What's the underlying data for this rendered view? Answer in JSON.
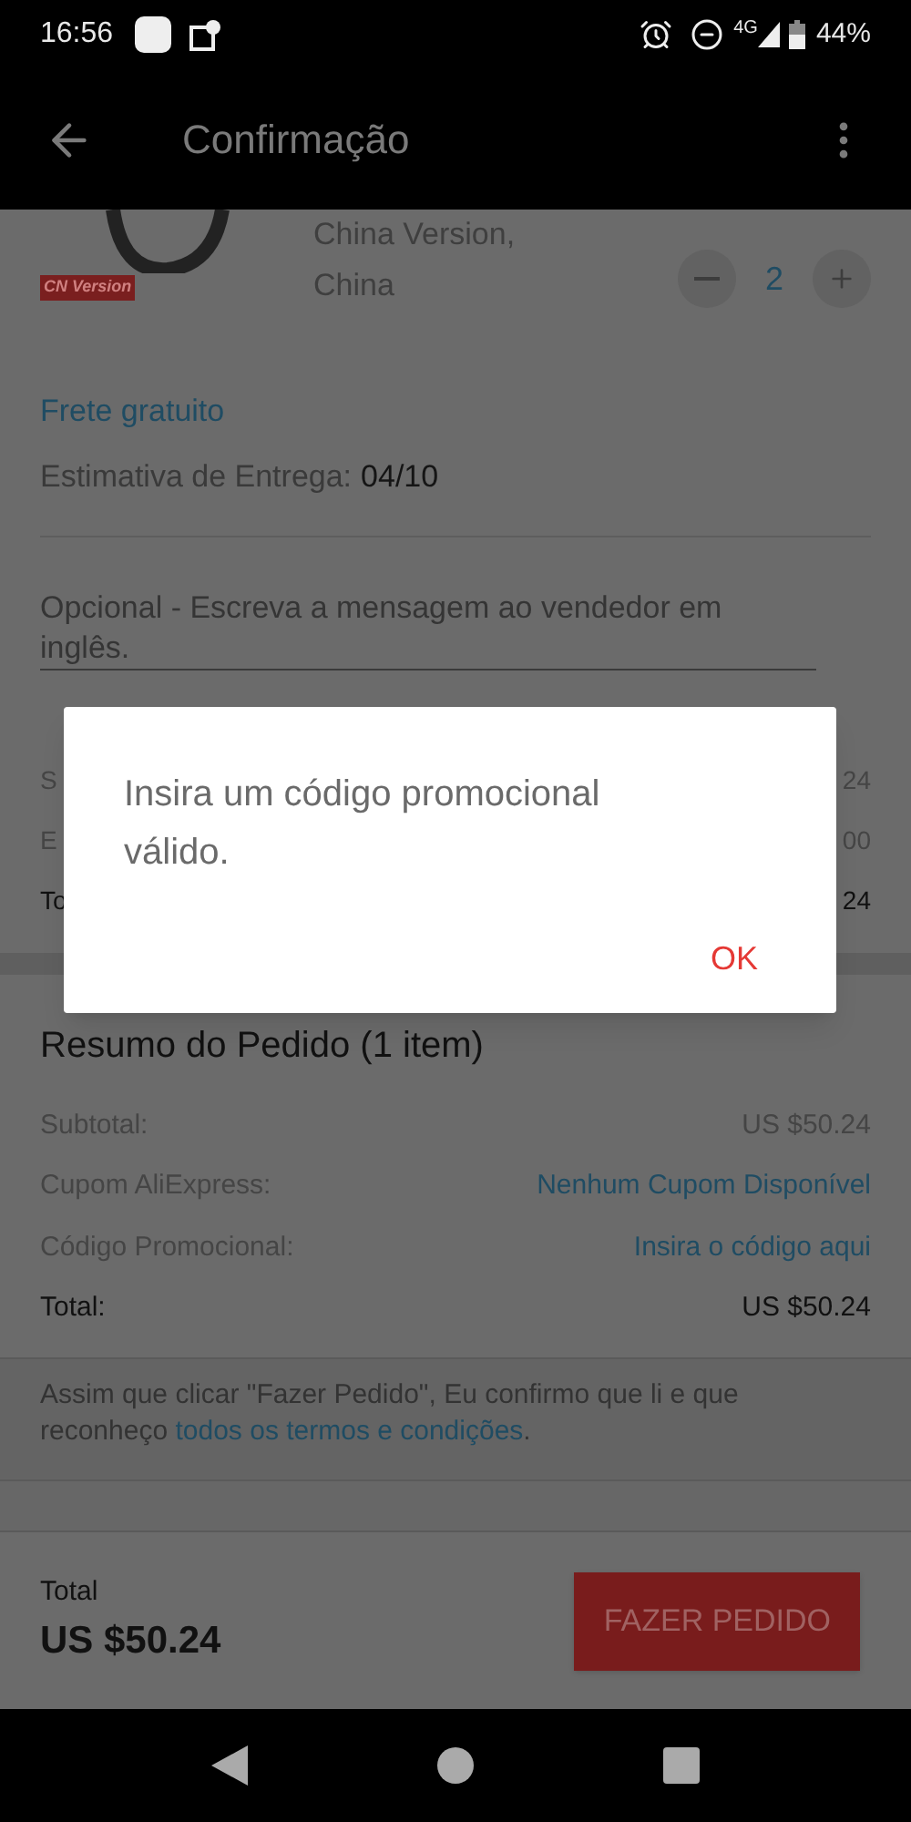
{
  "status_bar": {
    "time": "16:56",
    "network": "4G",
    "battery": "44%"
  },
  "app_bar": {
    "title": "Confirmação"
  },
  "product": {
    "badge": "CN Version",
    "variant_lines": [
      "China Version,",
      "China"
    ],
    "quantity": "2"
  },
  "shipping": {
    "free": "Frete gratuito",
    "estimate_label": "Estimativa de Entrega:",
    "estimate_value": "04/10"
  },
  "message_field": {
    "placeholder": "Opcional - Escreva a mensagem ao vendedor em inglês."
  },
  "covered_rows": [
    {
      "label": "S",
      "value": "24",
      "kind": "muted"
    },
    {
      "label": "E",
      "value": "00",
      "kind": "muted"
    },
    {
      "label": "To",
      "value": "24",
      "kind": "total"
    }
  ],
  "summary": {
    "title": "Resumo do Pedido (1 item)",
    "rows": [
      {
        "label": "Subtotal:",
        "value": "US $50.24",
        "kind": "muted"
      },
      {
        "label": "Cupom AliExpress:",
        "value": "Nenhum Cupom Disponível",
        "kind": "link"
      },
      {
        "label": "Código Promocional:",
        "value": "Insira o código aqui",
        "kind": "link"
      },
      {
        "label": "Total:",
        "value": "US $50.24",
        "kind": "total"
      }
    ]
  },
  "terms": {
    "text": "Assim que clicar \"Fazer Pedido\", Eu confirmo que li e que reconheço",
    "link": "todos os termos e condições",
    "end": "."
  },
  "bottom_bar": {
    "label": "Total",
    "amount": "US $50.24",
    "button": "FAZER PEDIDO"
  },
  "dialog": {
    "message": "Insira um código promocional válido.",
    "button": "OK"
  }
}
